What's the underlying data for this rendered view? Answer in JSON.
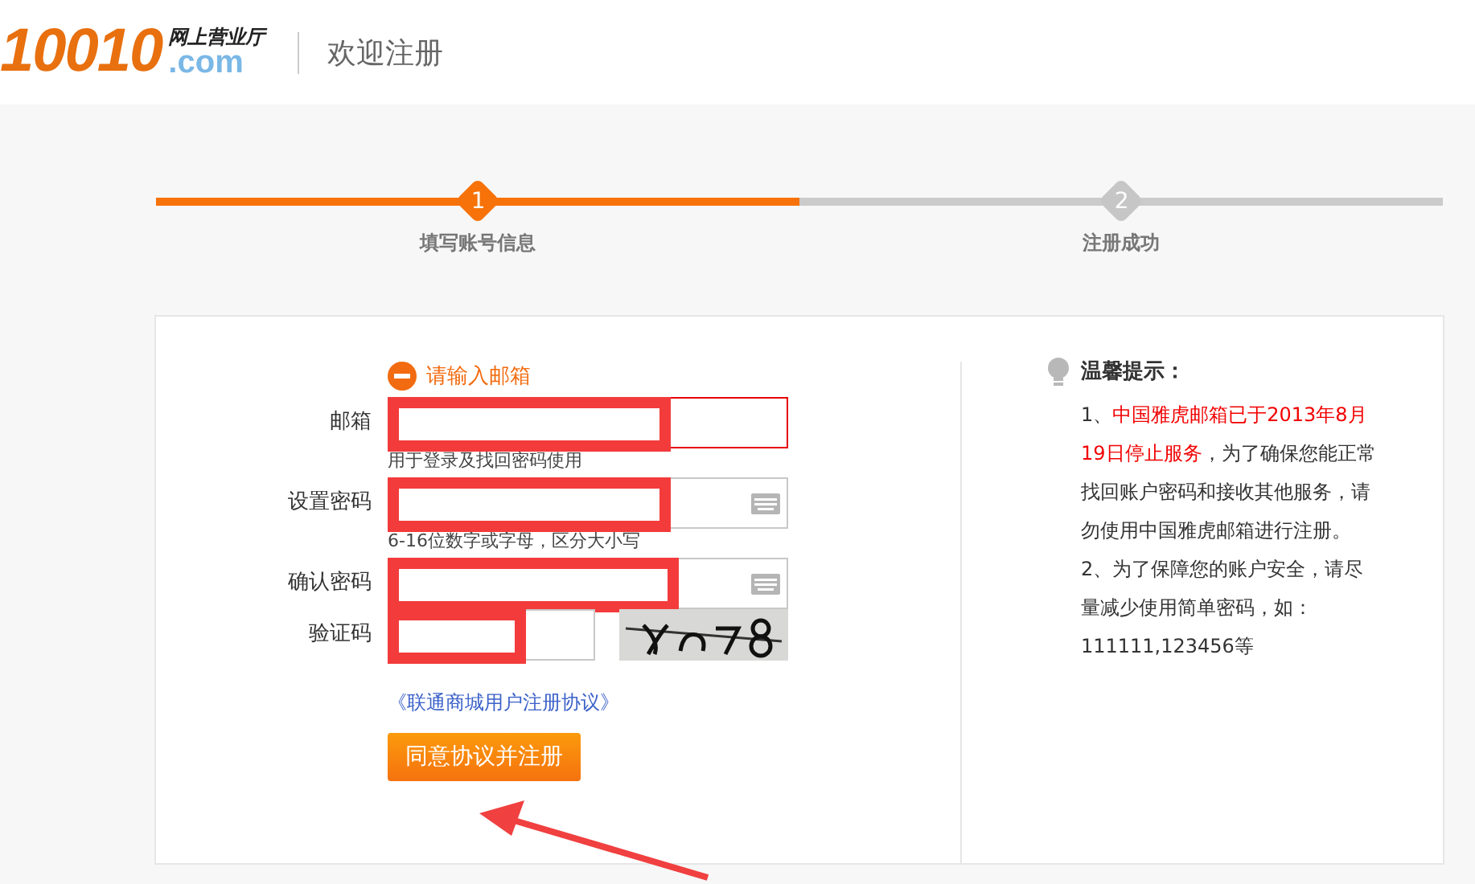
{
  "header": {
    "logo_number": "10010",
    "logo_tagline": "网上营业厅",
    "logo_domain": ".com",
    "page_title": "欢迎注册"
  },
  "steps": [
    {
      "number": "1",
      "label": "填写账号信息",
      "selected": true
    },
    {
      "number": "2",
      "label": "注册成功",
      "selected": false
    }
  ],
  "form": {
    "error": "请输入邮箱",
    "fields": [
      {
        "kind": "text",
        "label": "邮箱",
        "hint": "用于登录及找回密码使用",
        "invalid": true
      },
      {
        "kind": "password",
        "label": "设置密码",
        "hint": "6-16位数字或字母，区分大小写",
        "invalid": false
      },
      {
        "kind": "password",
        "label": "确认密码",
        "invalid": false
      },
      {
        "kind": "captcha",
        "label": "验证码",
        "invalid": false
      }
    ],
    "agreement_link": "《联通商城用户注册协议》",
    "submit": "同意协议并注册"
  },
  "tips": {
    "title": "温馨提示：",
    "items": [
      [
        {
          "text": "1、",
          "highlight": false
        },
        {
          "text": "中国雅虎邮箱已于2013年8月19日停止服务",
          "highlight": true
        },
        {
          "text": "，为了确保您能正常找回账户密码和接收其他服务，请勿使用中国雅虎邮箱进行注册。",
          "highlight": false
        }
      ],
      [
        {
          "text": "2、为了保障您的账户安全，请尽量减少使用简单密码，如：111111,123456等",
          "highlight": false
        }
      ]
    ]
  }
}
